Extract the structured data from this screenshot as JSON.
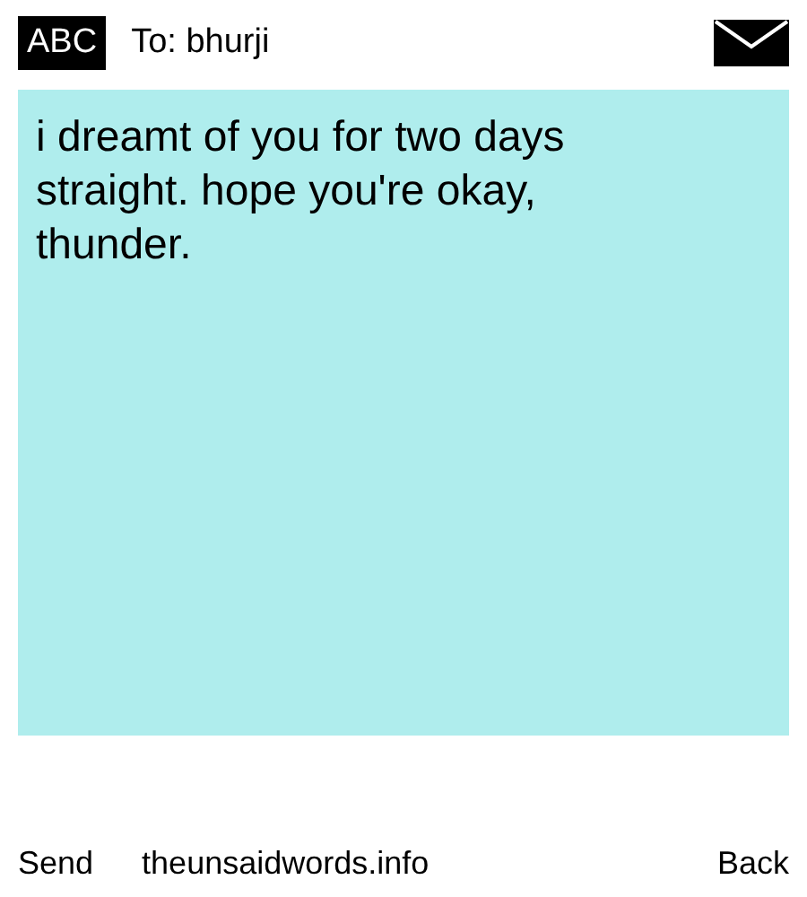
{
  "header": {
    "mode": "ABC",
    "recipient": "To: bhurji"
  },
  "message": "i dreamt of you for two days straight. hope you're okay, thunder.",
  "footer": {
    "left": "Send",
    "site": "theunsaidwords.info",
    "right": "Back"
  }
}
